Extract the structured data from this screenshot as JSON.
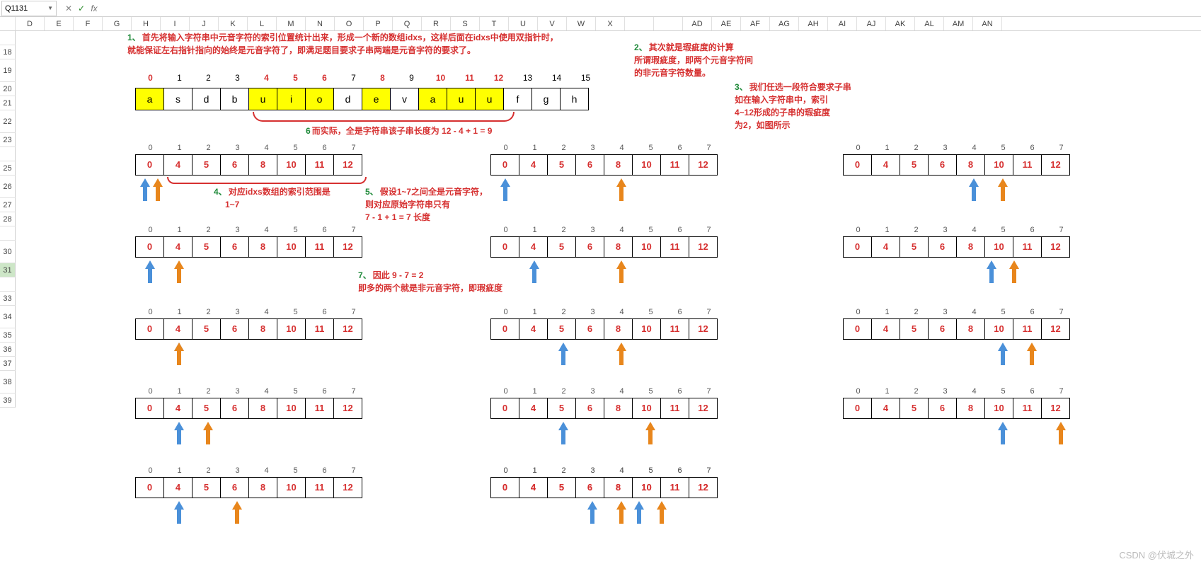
{
  "namebox": "Q1131",
  "col_headers": [
    "D",
    "E",
    "F",
    "G",
    "H",
    "I",
    "J",
    "K",
    "L",
    "M",
    "N",
    "O",
    "P",
    "Q",
    "R",
    "S",
    "T",
    "U",
    "V",
    "W",
    "X",
    "",
    "",
    "AD",
    "AE",
    "AF",
    "AG",
    "AH",
    "AI",
    "AJ",
    "AK",
    "AL",
    "AM",
    "AN"
  ],
  "row_headers": [
    "",
    "18",
    "19",
    "20",
    "21",
    "22",
    "23",
    "",
    "25",
    "26",
    "27",
    "28",
    "",
    "30",
    "31",
    "",
    "33",
    "34",
    "35",
    "36",
    "37",
    "38",
    "39"
  ],
  "notes": {
    "n1a": "首先将输入字符串中元音字符的索引位置统计出来，形成一个新的数组idxs，这样后面在idxs中使用双指针时，",
    "n1b": "就能保证左右指针指向的始终是元音字符了，即满足题目要求子串两端是元音字符的要求了。",
    "n1n": "1、",
    "n2a": "其次就是瑕疵度的计算",
    "n2b": "所谓瑕疵度，即两个元音字符间",
    "n2c": "的非元音字符数量。",
    "n2n": "2、",
    "n3a": "我们任选一段符合要求子串",
    "n3b": "如在输入字符串中，索引",
    "n3c": "4~12形成的子串的瑕疵度",
    "n3d": "为2，如图所示",
    "n3n": "3、",
    "n4": "对应idxs数组的索引范围是",
    "n4b": "1~7",
    "n4n": "4、",
    "n5a": "假设1~7之间全是元音字符，",
    "n5b": "则对应原始字符串只有",
    "n5c": "7 - 1 + 1 = 7 长度",
    "n5n": "5、",
    "n6": "而实际，全是字符串该子串长度为 12 - 4 + 1 = 9",
    "n6n": "6",
    "n7a": "因此 9 - 7 = 2",
    "n7b": "即多的两个就是非元音字符，即瑕疵度",
    "n7n": "7、"
  },
  "string": {
    "indices": [
      "0",
      "1",
      "2",
      "3",
      "4",
      "5",
      "6",
      "7",
      "8",
      "9",
      "10",
      "11",
      "12",
      "13",
      "14",
      "15"
    ],
    "vowel_idx": [
      0,
      4,
      5,
      6,
      8,
      10,
      11,
      12
    ],
    "chars": [
      "a",
      "s",
      "d",
      "b",
      "u",
      "i",
      "o",
      "d",
      "e",
      "v",
      "a",
      "u",
      "u",
      "f",
      "g",
      "h"
    ]
  },
  "idxs_hdr": [
    "0",
    "1",
    "2",
    "3",
    "4",
    "5",
    "6",
    "7"
  ],
  "idxs_vals": [
    "0",
    "4",
    "5",
    "6",
    "8",
    "10",
    "11",
    "12"
  ],
  "steps_center": [
    {
      "blue": 0,
      "orange": 4
    },
    {
      "blue": 1,
      "orange": 4
    },
    {
      "blue": 2,
      "orange": 4
    },
    {
      "blue": 2,
      "orange": 5
    },
    {
      "blue": 3,
      "orange": 4
    },
    {
      "blue": 4.6,
      "orange": 5.4
    }
  ],
  "steps_right": [
    {
      "blue": 4,
      "orange": 5
    },
    {
      "blue": 4.6,
      "orange": 5.4
    },
    {
      "blue": 5,
      "orange": 6
    },
    {
      "blue": 5,
      "orange": 7
    }
  ],
  "watermark": "CSDN @伏城之外",
  "chart_data": {
    "type": "table",
    "title": "Vowel index two-pointer illustration",
    "input_string": "asdbuiodevauufgh",
    "vowel_positions": [
      0,
      4,
      5,
      6,
      8,
      10,
      11,
      12
    ],
    "highlight_range": [
      4,
      12
    ],
    "actual_substring_length": 9,
    "idxs_range": [
      1,
      7
    ],
    "assumed_all_vowel_length": 7,
    "flaw_degree": 2
  }
}
